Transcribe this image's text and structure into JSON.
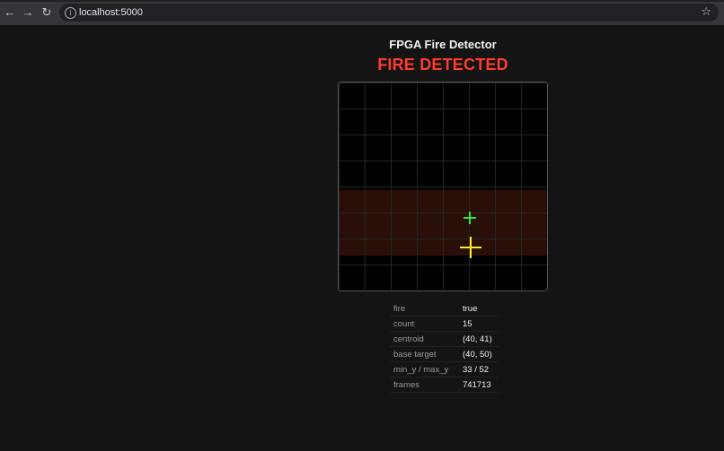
{
  "browser": {
    "url": "localhost:5000",
    "back_icon": "arrow-left",
    "forward_icon": "arrow-right",
    "reload_icon": "reload",
    "site_info_icon": "info-circle",
    "bookmark_icon": "star"
  },
  "app": {
    "title": "FPGA Fire Detector",
    "status": "FIRE DETECTED",
    "status_color": "#ff3b2f"
  },
  "view": {
    "centroid_color": "#33e633",
    "target_color": "#ffee22",
    "band_color": "#2a0e08"
  },
  "stats": [
    {
      "key": "fire",
      "value": "true"
    },
    {
      "key": "count",
      "value": "15"
    },
    {
      "key": "centroid",
      "value": "(40, 41)"
    },
    {
      "key": "base target",
      "value": "(40, 50)"
    },
    {
      "key": "min_y / max_y",
      "value": "33 / 52"
    },
    {
      "key": "frames",
      "value": "741713"
    }
  ]
}
